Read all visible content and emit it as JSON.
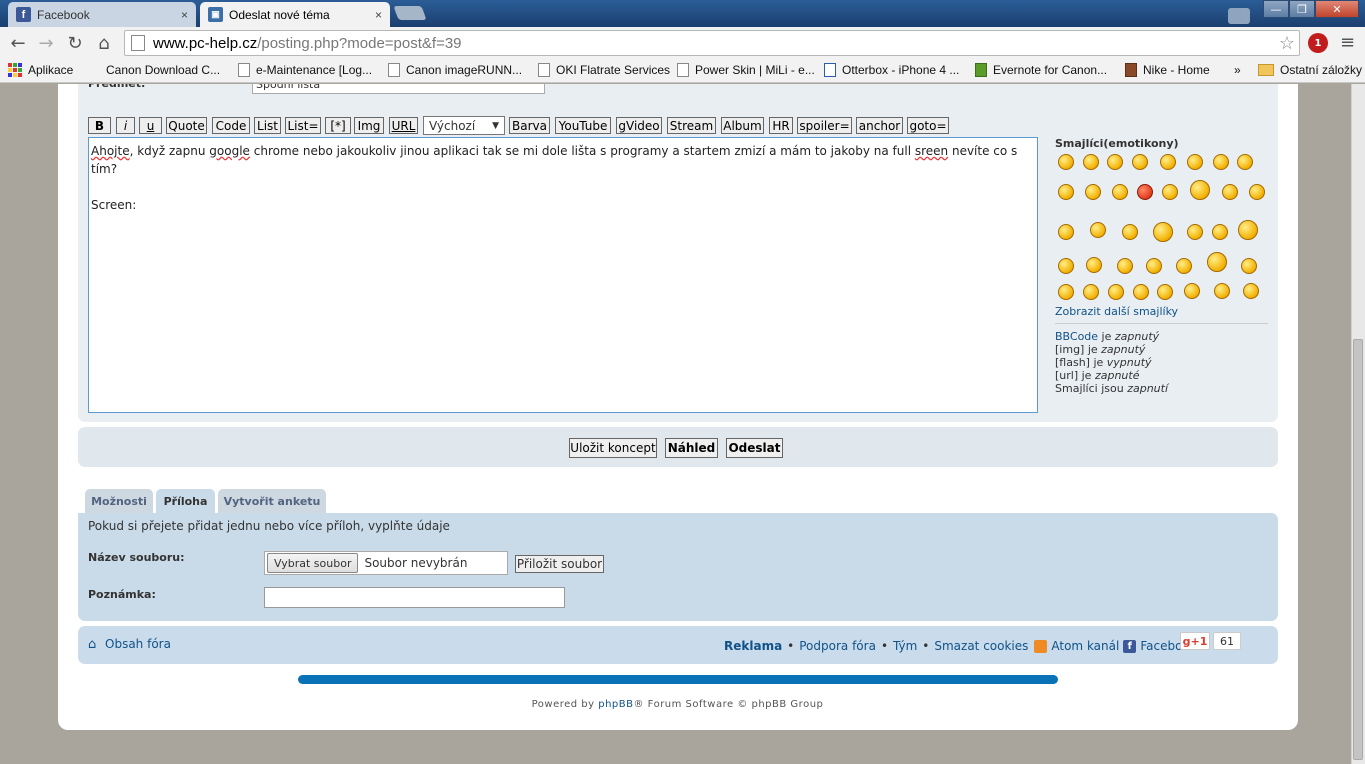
{
  "browser": {
    "tabs": [
      {
        "label": "Facebook",
        "icon": "facebook-icon",
        "close": "×"
      },
      {
        "label": "Odeslat nové téma",
        "icon": "site-favicon-icon",
        "close": "×"
      }
    ],
    "window_controls": {
      "minimize": "—",
      "maximize": "❐",
      "close": "✕"
    },
    "url_host": "www.pc-help.cz",
    "url_path": "/posting.php?mode=post&f=39",
    "extension_badge": "1",
    "bookmarks": [
      "Aplikace",
      "Canon Download C...",
      "e-Maintenance [Log...",
      "Canon imageRUNN...",
      "OKI Flatrate Services",
      "Power Skin | MiLi - e...",
      "Otterbox - iPhone 4 ...",
      "Evernote for Canon...",
      "Nike - Home"
    ],
    "bookmarks_overflow": "»",
    "other_bookmarks": "Ostatní záložky"
  },
  "form": {
    "subject_label": "Předmět:",
    "subject_value": "Spodní lišta",
    "bbcode_buttons": [
      "B",
      "i",
      "u",
      "Quote",
      "Code",
      "List",
      "List=",
      "[*]",
      "Img",
      "URL",
      "Barva",
      "YouTube",
      "gVideo",
      "Stream",
      "Album",
      "HR",
      "spoiler=",
      "anchor",
      "goto="
    ],
    "font_select": "Výchozí",
    "message_line1_words": {
      "w1": "Ahojte",
      "w2": ", když zapnu ",
      "w3": "google",
      "w4": " chrome nebo jakoukoliv jinou aplikaci tak se mi dole lišta s programy  a startem zmizí a mám to jakoby na full ",
      "w5": "sreen",
      "w6": " nevíte co s tím?"
    },
    "message_line2": "Screen:"
  },
  "smilies": {
    "title": "Smajlíci(emotikony)",
    "more": "Zobrazit další smajlíky"
  },
  "status": {
    "bbcode_link": "BBCode",
    "bbcode_is": " je ",
    "bbcode_state": "zapnutý",
    "img_label": "[img] je ",
    "img_state": "zapnutý",
    "flash_label": "[flash] je ",
    "flash_state": "vypnutý",
    "url_label": "[url] je ",
    "url_state": "zapnuté",
    "smilies_label": "Smajlíci jsou ",
    "smilies_state": "zapnutí"
  },
  "actions": {
    "save_draft": "Uložit koncept",
    "preview": "Náhled",
    "submit": "Odeslat"
  },
  "panel_tabs": [
    "Možnosti",
    "Příloha",
    "Vytvořit anketu"
  ],
  "attachment": {
    "intro": "Pokud si přejete přidat jednu nebo více příloh, vyplňte údaje",
    "filename_label": "Název souboru:",
    "choose_button": "Vybrat soubor",
    "no_file": "Soubor nevybrán",
    "add_button": "Přiložit soubor",
    "comment_label": "Poznámka:"
  },
  "footer": {
    "board_index": "Obsah fóra",
    "ads": "Reklama",
    "support": "Podpora fóra",
    "team": "Tým",
    "delete_cookies": "Smazat cookies",
    "atom": "Atom kanál",
    "facebook": "Facebook",
    "gplus": "g+1",
    "gplus_count": "61",
    "bullet": "•"
  },
  "powered": {
    "prefix": "Powered by ",
    "phpbb": "phpBB",
    "suffix": "® Forum Software © phpBB Group"
  },
  "colors": {
    "link": "#105289",
    "panel": "#e9eef2",
    "attach_panel": "#c9dae8",
    "scrollbar_accent": "#0a73b8"
  }
}
